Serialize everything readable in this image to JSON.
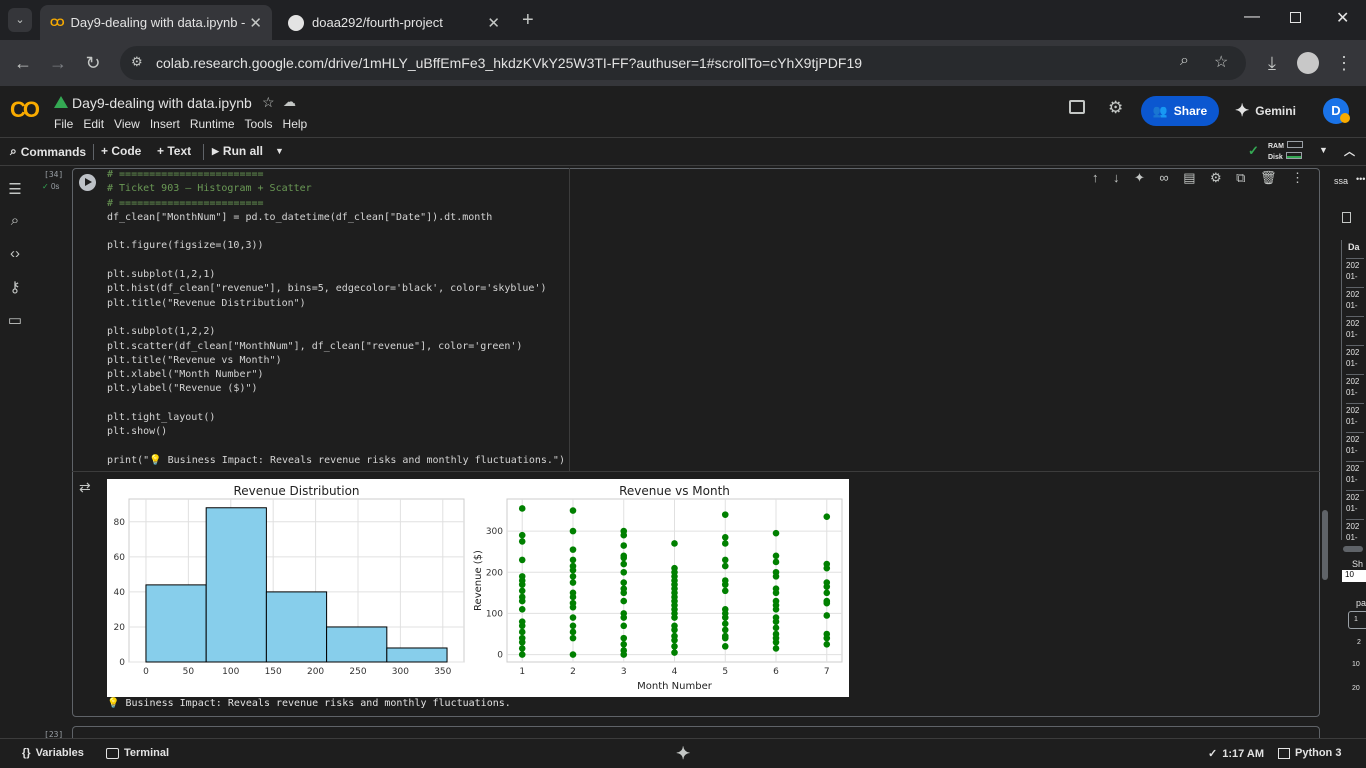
{
  "browser": {
    "tabs": [
      {
        "title": "Day9-dealing with data.ipynb -",
        "active": true
      },
      {
        "title": "doaa292/fourth-project",
        "active": false
      }
    ],
    "url": "colab.research.google.com/drive/1mHLY_uBffEmFe3_hkdzKVkY25W3TI-FF?authuser=1#scrollTo=cYhX9tjPDF19"
  },
  "colab": {
    "logo": "CO",
    "notebook_title": "Day9-dealing with data.ipynb",
    "menu": [
      "File",
      "Edit",
      "View",
      "Insert",
      "Runtime",
      "Tools",
      "Help"
    ],
    "share_label": "Share",
    "gemini_label": "Gemini",
    "avatar_letter": "D",
    "toolbar": {
      "commands": "Commands",
      "code": "+ Code",
      "text": "+ Text",
      "run_all": "Run all",
      "ram": "RAM",
      "disk": "Disk"
    }
  },
  "cell": {
    "exec_count": "[34]",
    "exec_time": "0s",
    "code_lines": [
      {
        "t": "# ========================",
        "k": "comment"
      },
      {
        "t": "# Ticket 903 – Histogram + Scatter",
        "k": "comment"
      },
      {
        "t": "# ========================",
        "k": "comment"
      },
      {
        "t": "df_clean[\"MonthNum\"] = pd.to_datetime(df_clean[\"Date\"]).dt.month",
        "k": "code"
      },
      {
        "t": "",
        "k": "code"
      },
      {
        "t": "plt.figure(figsize=(10,3))",
        "k": "code"
      },
      {
        "t": "",
        "k": "code"
      },
      {
        "t": "plt.subplot(1,2,1)",
        "k": "code"
      },
      {
        "t": "plt.hist(df_clean[\"revenue\"], bins=5, edgecolor='black', color='skyblue')",
        "k": "code"
      },
      {
        "t": "plt.title(\"Revenue Distribution\")",
        "k": "code"
      },
      {
        "t": "",
        "k": "code"
      },
      {
        "t": "plt.subplot(1,2,2)",
        "k": "code"
      },
      {
        "t": "plt.scatter(df_clean[\"MonthNum\"], df_clean[\"revenue\"], color='green')",
        "k": "code"
      },
      {
        "t": "plt.title(\"Revenue vs Month\")",
        "k": "code"
      },
      {
        "t": "plt.xlabel(\"Month Number\")",
        "k": "code"
      },
      {
        "t": "plt.ylabel(\"Revenue ($)\")",
        "k": "code"
      },
      {
        "t": "",
        "k": "code"
      },
      {
        "t": "plt.tight_layout()",
        "k": "code"
      },
      {
        "t": "plt.show()",
        "k": "code"
      },
      {
        "t": "",
        "k": "code"
      },
      {
        "t": "print(\"💡 Business Impact: Reveals revenue risks and monthly fluctuations.\")",
        "k": "code"
      }
    ],
    "output_text": "💡 Business Impact: Reveals revenue risks and monthly fluctuations.",
    "next_exec_count": "[23]"
  },
  "chart_data": [
    {
      "type": "bar",
      "title": "Revenue Distribution",
      "bins": [
        [
          0,
          71
        ],
        [
          71,
          142
        ],
        [
          142,
          213
        ],
        [
          213,
          284
        ],
        [
          284,
          355
        ]
      ],
      "values": [
        44,
        88,
        40,
        20,
        8
      ],
      "xticks": [
        0,
        50,
        100,
        150,
        200,
        250,
        300,
        350
      ],
      "yticks": [
        0,
        20,
        40,
        60,
        80
      ],
      "xlim": [
        -20,
        375
      ],
      "ylim": [
        0,
        93
      ],
      "color": "#87ceeb",
      "edgecolor": "#000000"
    },
    {
      "type": "scatter",
      "title": "Revenue vs Month",
      "xlabel": "Month Number",
      "ylabel": "Revenue ($)",
      "xticks": [
        1,
        2,
        3,
        4,
        5,
        6,
        7
      ],
      "yticks": [
        0,
        100,
        200,
        300
      ],
      "xlim": [
        0.7,
        7.3
      ],
      "ylim": [
        -18,
        378
      ],
      "color": "#008000",
      "points": [
        [
          1,
          355
        ],
        [
          1,
          290
        ],
        [
          1,
          275
        ],
        [
          1,
          230
        ],
        [
          1,
          190
        ],
        [
          1,
          180
        ],
        [
          1,
          170
        ],
        [
          1,
          155
        ],
        [
          1,
          140
        ],
        [
          1,
          130
        ],
        [
          1,
          110
        ],
        [
          1,
          80
        ],
        [
          1,
          70
        ],
        [
          1,
          55
        ],
        [
          1,
          40
        ],
        [
          1,
          30
        ],
        [
          1,
          15
        ],
        [
          1,
          0
        ],
        [
          2,
          350
        ],
        [
          2,
          300
        ],
        [
          2,
          255
        ],
        [
          2,
          230
        ],
        [
          2,
          215
        ],
        [
          2,
          205
        ],
        [
          2,
          190
        ],
        [
          2,
          175
        ],
        [
          2,
          150
        ],
        [
          2,
          140
        ],
        [
          2,
          125
        ],
        [
          2,
          115
        ],
        [
          2,
          90
        ],
        [
          2,
          70
        ],
        [
          2,
          55
        ],
        [
          2,
          40
        ],
        [
          2,
          0
        ],
        [
          3,
          300
        ],
        [
          3,
          290
        ],
        [
          3,
          265
        ],
        [
          3,
          240
        ],
        [
          3,
          235
        ],
        [
          3,
          220
        ],
        [
          3,
          200
        ],
        [
          3,
          175
        ],
        [
          3,
          160
        ],
        [
          3,
          150
        ],
        [
          3,
          130
        ],
        [
          3,
          100
        ],
        [
          3,
          90
        ],
        [
          3,
          70
        ],
        [
          3,
          40
        ],
        [
          3,
          25
        ],
        [
          3,
          10
        ],
        [
          3,
          0
        ],
        [
          4,
          270
        ],
        [
          4,
          210
        ],
        [
          4,
          200
        ],
        [
          4,
          190
        ],
        [
          4,
          180
        ],
        [
          4,
          170
        ],
        [
          4,
          160
        ],
        [
          4,
          150
        ],
        [
          4,
          140
        ],
        [
          4,
          130
        ],
        [
          4,
          120
        ],
        [
          4,
          110
        ],
        [
          4,
          100
        ],
        [
          4,
          90
        ],
        [
          4,
          70
        ],
        [
          4,
          60
        ],
        [
          4,
          45
        ],
        [
          4,
          35
        ],
        [
          4,
          20
        ],
        [
          4,
          5
        ],
        [
          5,
          340
        ],
        [
          5,
          285
        ],
        [
          5,
          270
        ],
        [
          5,
          230
        ],
        [
          5,
          215
        ],
        [
          5,
          180
        ],
        [
          5,
          170
        ],
        [
          5,
          155
        ],
        [
          5,
          110
        ],
        [
          5,
          100
        ],
        [
          5,
          90
        ],
        [
          5,
          75
        ],
        [
          5,
          60
        ],
        [
          5,
          45
        ],
        [
          5,
          40
        ],
        [
          5,
          20
        ],
        [
          6,
          295
        ],
        [
          6,
          240
        ],
        [
          6,
          225
        ],
        [
          6,
          200
        ],
        [
          6,
          190
        ],
        [
          6,
          160
        ],
        [
          6,
          150
        ],
        [
          6,
          130
        ],
        [
          6,
          120
        ],
        [
          6,
          110
        ],
        [
          6,
          90
        ],
        [
          6,
          80
        ],
        [
          6,
          65
        ],
        [
          6,
          50
        ],
        [
          6,
          40
        ],
        [
          6,
          30
        ],
        [
          6,
          15
        ],
        [
          7,
          335
        ],
        [
          7,
          220
        ],
        [
          7,
          210
        ],
        [
          7,
          175
        ],
        [
          7,
          165
        ],
        [
          7,
          150
        ],
        [
          7,
          130
        ],
        [
          7,
          125
        ],
        [
          7,
          95
        ],
        [
          7,
          50
        ],
        [
          7,
          40
        ],
        [
          7,
          25
        ]
      ]
    }
  ],
  "right_panel": {
    "header": "ssa",
    "column": "Da",
    "rows": [
      "202 01-",
      "202 01-",
      "202 01-",
      "202 01-",
      "202 01-",
      "202 01-",
      "202 01-",
      "202 01-",
      "202 01-",
      "202 01-"
    ],
    "show_label": "Sh",
    "page_size": "10",
    "page_label": "pa",
    "page_options": [
      "1",
      "2",
      "10",
      "20"
    ]
  },
  "statusbar": {
    "variables": "Variables",
    "terminal": "Terminal",
    "time": "1:17 AM",
    "kernel": "Python 3"
  }
}
